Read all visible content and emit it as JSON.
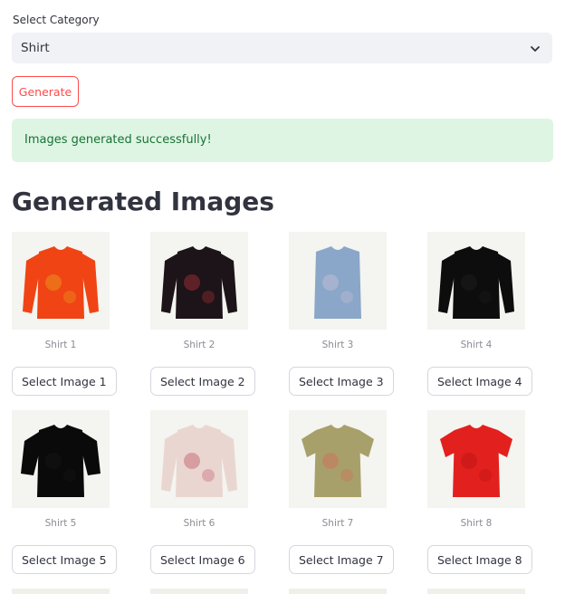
{
  "category": {
    "label": "Select Category",
    "selected": "Shirt",
    "icon": "chevron-down-icon"
  },
  "generate_button": {
    "label": "Generate",
    "color": "#ff4b4b"
  },
  "alert": {
    "message": "Images generated successfully!",
    "background": "#dff5e4",
    "text_color": "#177233"
  },
  "section_title": "Generated Images",
  "images": [
    {
      "caption": "Shirt 1",
      "button": "Select Image 1",
      "color": "#f04414",
      "accent": "#e8a020",
      "sleeve": "long"
    },
    {
      "caption": "Shirt 2",
      "button": "Select Image 2",
      "color": "#1c1418",
      "accent": "#b0303a",
      "sleeve": "long"
    },
    {
      "caption": "Shirt 3",
      "button": "Select Image 3",
      "color": "#8aa6c8",
      "accent": "#c7c0d8",
      "sleeve": "none"
    },
    {
      "caption": "Shirt 4",
      "button": "Select Image 4",
      "color": "#0d0d0d",
      "accent": "#1e1e1e",
      "sleeve": "long"
    },
    {
      "caption": "Shirt 5",
      "button": "Select Image 5",
      "color": "#0a0a0a",
      "accent": "#161616",
      "sleeve": "mid"
    },
    {
      "caption": "Shirt 6",
      "button": "Select Image 6",
      "color": "#ead6d0",
      "accent": "#c25a6a",
      "sleeve": "long"
    },
    {
      "caption": "Shirt 7",
      "button": "Select Image 7",
      "color": "#a8a06a",
      "accent": "#d46a5a",
      "sleeve": "short"
    },
    {
      "caption": "Shirt 8",
      "button": "Select Image 8",
      "color": "#e2201e",
      "accent": "#b81414",
      "sleeve": "short"
    }
  ]
}
